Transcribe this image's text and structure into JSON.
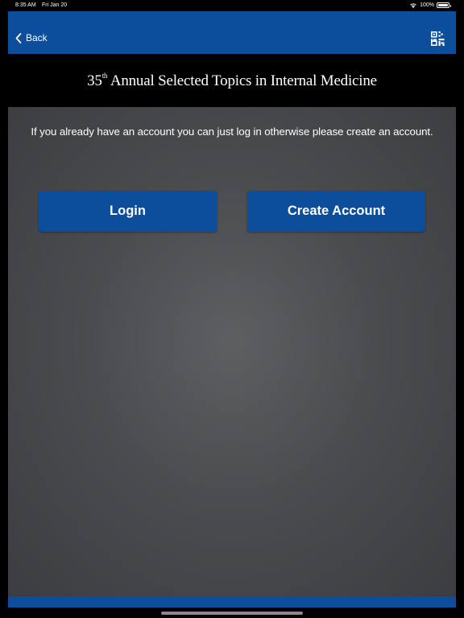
{
  "status_bar": {
    "time": "8:35 AM",
    "date": "Fri Jan 20",
    "battery": "100%"
  },
  "nav": {
    "back_label": "Back",
    "back_icon": "chevron-left-icon",
    "scan_icon": "qr-code-icon"
  },
  "header": {
    "title_prefix": "35",
    "title_superscript": "th",
    "title_rest": " Annual Selected Topics in Internal Medicine"
  },
  "main": {
    "info_text": "If you already have an account you can just log in otherwise please create an account.",
    "login_label": "Login",
    "create_account_label": "Create Account"
  },
  "colors": {
    "brand_blue": "#0c4e9b",
    "background": "#000000",
    "content_gray": "#4a4c4f"
  }
}
